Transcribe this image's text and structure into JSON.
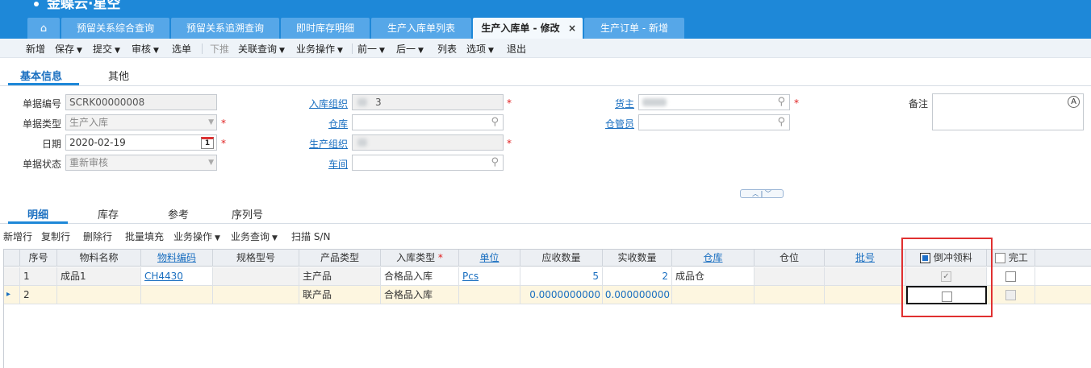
{
  "app": {
    "logo_text": "金蝶云·星空"
  },
  "tabs": [
    {
      "label": "预留关系综合查询"
    },
    {
      "label": "预留关系追溯查询"
    },
    {
      "label": "即时库存明细"
    },
    {
      "label": "生产入库单列表"
    },
    {
      "label": "生产入库单 - 修改",
      "active": true,
      "close": "×"
    },
    {
      "label": "生产订单 - 新增"
    }
  ],
  "icons": {
    "home": "home-icon",
    "search": "search-icon",
    "calendar": "calendar-icon",
    "dropdown": "chevron-down-icon",
    "attach": "attach-icon"
  },
  "toolbar": {
    "new": "新增",
    "save": "保存",
    "submit": "提交",
    "audit": "审核",
    "select": "选单",
    "push": "下推",
    "related_query": "关联查询",
    "business_op": "业务操作",
    "prev": "前一",
    "next": "后一",
    "list": "列表",
    "options": "选项",
    "exit": "退出"
  },
  "form_tabs": {
    "basic": "基本信息",
    "other": "其他"
  },
  "form": {
    "bill_no": {
      "label": "单据编号",
      "value": "SCRK00000008"
    },
    "bill_type": {
      "label": "单据类型",
      "value": "生产入库"
    },
    "date": {
      "label": "日期",
      "value": "2020-02-19"
    },
    "bill_status": {
      "label": "单据状态",
      "value": "重新审核"
    },
    "stock_org": {
      "label": "入库组织",
      "value": "3"
    },
    "warehouse": {
      "label": "仓库",
      "value": ""
    },
    "prd_org": {
      "label": "生产组织",
      "value": ""
    },
    "workshop": {
      "label": "车间",
      "value": ""
    },
    "owner": {
      "label": "货主",
      "value": ""
    },
    "stock_keeper": {
      "label": "仓管员",
      "value": ""
    },
    "remark": {
      "label": "备注",
      "value": ""
    },
    "required_mark": "*",
    "calendar_day": "1"
  },
  "collapse_toggle": "︿ | ﹀",
  "detail_tabs": {
    "detail": "明细",
    "inventory": "库存",
    "reference": "参考",
    "serial": "序列号"
  },
  "grid_toolbar": {
    "add_row": "新增行",
    "copy_row": "复制行",
    "delete_row": "删除行",
    "batch_fill": "批量填充",
    "business_op": "业务操作",
    "business_query": "业务查询",
    "scan_sn": "扫描 S/N"
  },
  "grid": {
    "columns": {
      "seq": "序号",
      "material_name": "物料名称",
      "material_code": "物料编码",
      "spec": "规格型号",
      "product_type": "产品类型",
      "in_type": "入库类型",
      "unit": "单位",
      "must_qty": "应收数量",
      "real_qty": "实收数量",
      "stock": "仓库",
      "stock_loc": "仓位",
      "lot": "批号",
      "backflush": "倒冲领料",
      "finished": "完工"
    },
    "rows": [
      {
        "seq": "1",
        "material_name": "成品1",
        "material_code": "CH4430",
        "spec": "",
        "product_type": "主产品",
        "in_type": "合格品入库",
        "unit": "Pcs",
        "must_qty": "5",
        "real_qty": "2",
        "stock": "成品仓",
        "stock_loc": "",
        "lot": "",
        "backflush": true,
        "finished": false
      },
      {
        "seq": "2",
        "material_name": "",
        "material_code": "",
        "spec": "",
        "product_type": "联产品",
        "in_type": "合格品入库",
        "unit": "",
        "must_qty": "0.0000000000",
        "real_qty": "0.000000000",
        "stock": "",
        "stock_loc": "",
        "lot": "",
        "backflush": false,
        "finished": false
      }
    ],
    "current_row_marker": "▸"
  },
  "colors": {
    "header_blue": "#1e88d8",
    "tab_blue": "#56a7e8",
    "highlight_red": "#e03030",
    "link_blue": "#1a6fc0",
    "selected_row": "#fdf6e0"
  }
}
